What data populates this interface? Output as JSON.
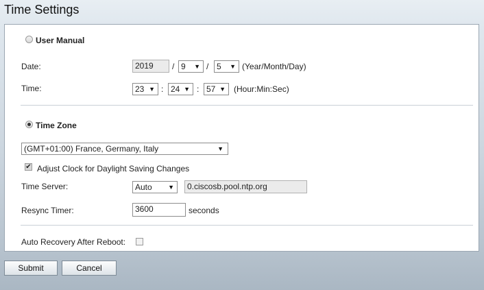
{
  "page": {
    "title": "Time Settings"
  },
  "user_manual": {
    "label": "User Manual",
    "selected": false,
    "date": {
      "label": "Date:",
      "year": "2019",
      "month": "9",
      "day": "5",
      "separator": "/",
      "format_hint": "(Year/Month/Day)"
    },
    "time": {
      "label": "Time:",
      "hour": "23",
      "minute": "24",
      "second": "57",
      "separator": ":",
      "format_hint": "(Hour:Min:Sec)"
    }
  },
  "time_zone": {
    "label": "Time Zone",
    "selected": true,
    "value": "(GMT+01:00) France, Germany, Italy",
    "dst": {
      "label": "Adjust Clock for Daylight Saving Changes",
      "checked": true
    },
    "time_server": {
      "label": "Time Server:",
      "mode": "Auto",
      "address": "0.ciscosb.pool.ntp.org"
    },
    "resync": {
      "label": "Resync Timer:",
      "value": "3600",
      "unit": "seconds"
    }
  },
  "auto_recovery": {
    "label": "Auto Recovery After Reboot:",
    "checked": false
  },
  "buttons": {
    "submit": "Submit",
    "cancel": "Cancel"
  },
  "icons": {
    "dropdown": "▼",
    "check": "✔"
  },
  "colors": {
    "panel_border": "#9aa6b2",
    "readonly_field": "#ebebeb"
  }
}
